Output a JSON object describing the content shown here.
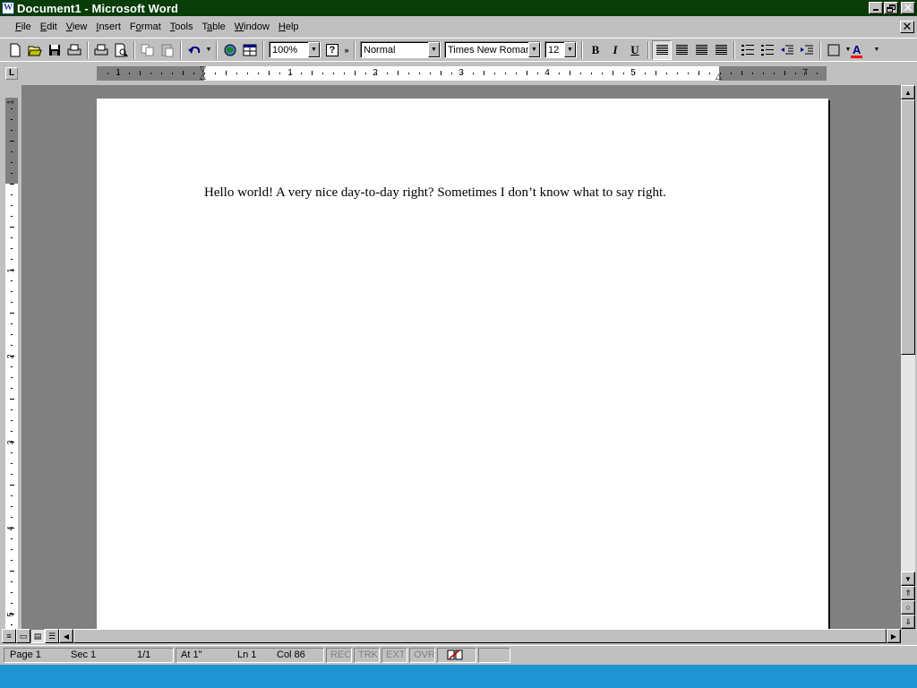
{
  "window": {
    "title": "Document1 - Microsoft Word",
    "app_icon": "word-icon"
  },
  "menu": {
    "items": [
      {
        "accel": "F",
        "rest": "ile"
      },
      {
        "accel": "E",
        "rest": "dit"
      },
      {
        "accel": "V",
        "rest": "iew"
      },
      {
        "accel": "I",
        "rest": "nsert"
      },
      {
        "pre": "F",
        "accel": "o",
        "rest": "rmat"
      },
      {
        "accel": "T",
        "rest": "ools"
      },
      {
        "pre": "T",
        "accel": "a",
        "rest": "ble"
      },
      {
        "accel": "W",
        "rest": "indow"
      },
      {
        "accel": "H",
        "rest": "elp"
      }
    ]
  },
  "toolbar": {
    "zoom": "100%",
    "style": "Normal",
    "font": "Times New Roman",
    "size": "12",
    "bold": "B",
    "italic": "I",
    "underline": "U",
    "font_color_letter": "A",
    "font_color": "#ff0000",
    "help": "?"
  },
  "ruler": {
    "h_numbers": [
      "1",
      "1",
      "2",
      "3",
      "4",
      "5",
      "7"
    ],
    "v_numbers": [
      "1",
      "1",
      "2",
      "3",
      "4",
      "5"
    ]
  },
  "document": {
    "text": "Hello world! A very nice day-to-day right? Sometimes I don’t know what to say right."
  },
  "status": {
    "page": "Page 1",
    "section": "Sec 1",
    "pages": "1/1",
    "at": "At 1\"",
    "line": "Ln 1",
    "col": "Col 86",
    "rec": "REC",
    "trk": "TRK",
    "ext": "EXT",
    "ovr": "OVR"
  },
  "colors": {
    "titlebar": "#083c08",
    "taskbar": "#1e95d2"
  }
}
